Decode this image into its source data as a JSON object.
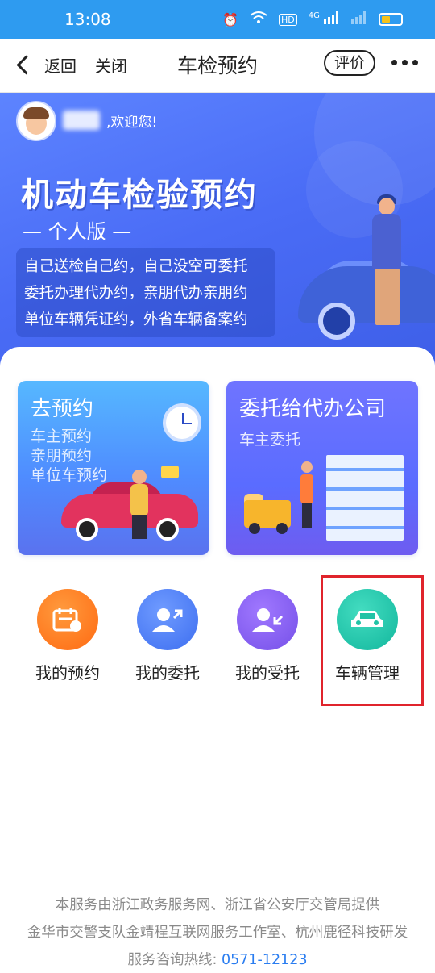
{
  "status_bar": {
    "time": "13:08",
    "network": "4G"
  },
  "nav": {
    "back_label": "返回",
    "close_label": "关闭",
    "title": "车检预约",
    "rate_label": "评价"
  },
  "banner": {
    "welcome": ",欢迎您!",
    "title": "机动车检验预约",
    "subtitle": "— 个人版 —",
    "slogans": [
      "自己送检自己约，自己没空可委托",
      "委托办理代办约，亲朋代办亲朋约",
      "单位车辆凭证约，外省车辆备案约"
    ]
  },
  "tiles": {
    "reserve": {
      "title": "去预约",
      "lines": [
        "车主预约",
        "亲朋预约",
        "单位车预约"
      ]
    },
    "entrust": {
      "title": "委托给代办公司",
      "lines": [
        "车主委托"
      ]
    }
  },
  "menu": [
    {
      "label": "我的预约",
      "icon": "calendar-icon",
      "color": "#ff7a1f"
    },
    {
      "label": "我的委托",
      "icon": "user-arrow-out-icon",
      "color": "#4a7af4"
    },
    {
      "label": "我的受托",
      "icon": "user-arrow-in-icon",
      "color": "#8460f0"
    },
    {
      "label": "车辆管理",
      "icon": "car-icon",
      "color": "#1fc2a5"
    }
  ],
  "footer": {
    "line1": "本服务由浙江政务服务网、浙江省公安厅交管局提供",
    "line2": "金华市交警支队金靖程互联网服务工作室、杭州鹿径科技研发",
    "hotline_label": "服务咨询热线:",
    "hotline_number": "0571-12123"
  },
  "colors": {
    "status_bar": "#2e9bf0",
    "banner": "#4a6cf6",
    "highlight": "#e0242c",
    "hotline": "#2a7df0"
  }
}
